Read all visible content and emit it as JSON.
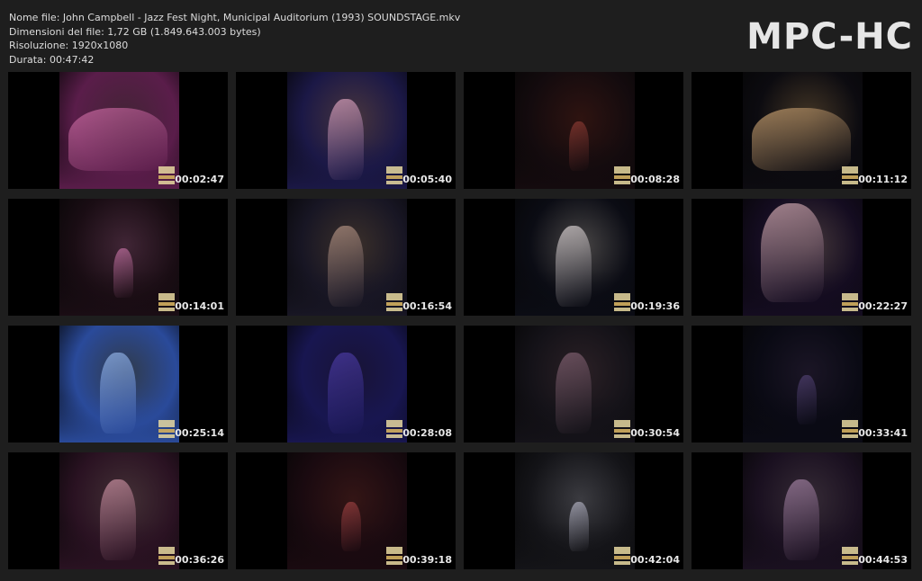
{
  "info": {
    "filename": "Nome file: John Campbell - Jazz Fest Night, Municipal Auditorium (1993) SOUNDSTAGE.mkv",
    "filesize": "Dimensioni del file: 1,72 GB (1.849.643.003 bytes)",
    "resolution": "Risoluzione: 1920x1080",
    "duration": "Durata: 00:47:42"
  },
  "logo": "MPC-HC",
  "thumbnails": [
    {
      "time": "00:02:47",
      "bg": "#5a1d4a",
      "accent": "#c86aa0",
      "subject": "guitar-closeup"
    },
    {
      "time": "00:05:40",
      "bg": "#1b1846",
      "accent": "#d8a0b8",
      "subject": "drummer"
    },
    {
      "time": "00:08:28",
      "bg": "#140b0e",
      "accent": "#8a3a32",
      "subject": "stage-wide"
    },
    {
      "time": "00:11:12",
      "bg": "#0c0b10",
      "accent": "#c8a070",
      "subject": "guitar-closeup"
    },
    {
      "time": "00:14:01",
      "bg": "#1a0d14",
      "accent": "#c070a0",
      "subject": "stage-wide"
    },
    {
      "time": "00:16:54",
      "bg": "#181624",
      "accent": "#b09080",
      "subject": "singer"
    },
    {
      "time": "00:19:36",
      "bg": "#0b0c14",
      "accent": "#d8d0d0",
      "subject": "guitarist"
    },
    {
      "time": "00:22:27",
      "bg": "#140c20",
      "accent": "#d0a8b0",
      "subject": "face-closeup"
    },
    {
      "time": "00:25:14",
      "bg": "#2a4a9a",
      "accent": "#90b0e0",
      "subject": "bassist"
    },
    {
      "time": "00:28:08",
      "bg": "#181650",
      "accent": "#4a3aa0",
      "subject": "singer"
    },
    {
      "time": "00:30:54",
      "bg": "#141218",
      "accent": "#806070",
      "subject": "guitarist"
    },
    {
      "time": "00:33:41",
      "bg": "#0a0a14",
      "accent": "#504070",
      "subject": "stage-dark"
    },
    {
      "time": "00:36:26",
      "bg": "#2a1222",
      "accent": "#c890a0",
      "subject": "guitarist"
    },
    {
      "time": "00:39:18",
      "bg": "#1a0a10",
      "accent": "#9a4040",
      "subject": "stage-wide"
    },
    {
      "time": "00:42:04",
      "bg": "#141418",
      "accent": "#b0b0c0",
      "subject": "stage-wide"
    },
    {
      "time": "00:44:53",
      "bg": "#1a1020",
      "accent": "#a080a0",
      "subject": "singer"
    }
  ]
}
